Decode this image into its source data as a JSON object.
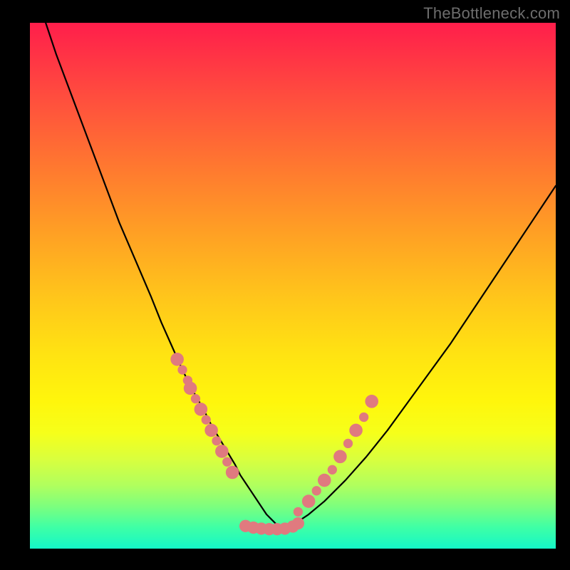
{
  "watermark": "TheBottleneck.com",
  "chart_data": {
    "type": "line",
    "title": "",
    "xlabel": "",
    "ylabel": "",
    "xlim": [
      0,
      100
    ],
    "ylim": [
      0,
      100
    ],
    "series": [
      {
        "name": "curve",
        "x": [
          3,
          5,
          8,
          11,
          14,
          17,
          20,
          23,
          25,
          27,
          29,
          31,
          33,
          34.5,
          36,
          37.5,
          39,
          40,
          41,
          42,
          43,
          44,
          45,
          46,
          47,
          48,
          50,
          53,
          56,
          60,
          64,
          68,
          72,
          76,
          80,
          84,
          88,
          92,
          96,
          100
        ],
        "y": [
          100,
          94,
          86,
          78,
          70,
          62,
          55,
          48,
          43,
          38.5,
          34,
          30,
          26.5,
          23.5,
          21,
          18.5,
          16,
          14,
          12.5,
          11,
          9.5,
          8,
          6.5,
          5.5,
          4.5,
          4,
          4.5,
          6.5,
          9,
          13,
          17.5,
          22.5,
          28,
          33.5,
          39,
          45,
          51,
          57,
          63,
          69
        ]
      }
    ],
    "markers": [
      {
        "x": 28,
        "y": 36,
        "r": 1.4
      },
      {
        "x": 29,
        "y": 34,
        "r": 1.0
      },
      {
        "x": 30,
        "y": 32,
        "r": 1.0
      },
      {
        "x": 30.5,
        "y": 30.5,
        "r": 1.4
      },
      {
        "x": 31.5,
        "y": 28.5,
        "r": 1.0
      },
      {
        "x": 32.5,
        "y": 26.5,
        "r": 1.4
      },
      {
        "x": 33.5,
        "y": 24.5,
        "r": 1.0
      },
      {
        "x": 34.5,
        "y": 22.5,
        "r": 1.4
      },
      {
        "x": 35.5,
        "y": 20.5,
        "r": 1.0
      },
      {
        "x": 36.5,
        "y": 18.5,
        "r": 1.4
      },
      {
        "x": 37.5,
        "y": 16.5,
        "r": 1.0
      },
      {
        "x": 38.5,
        "y": 14.5,
        "r": 1.4
      },
      {
        "x": 41,
        "y": 4.3,
        "r": 1.3
      },
      {
        "x": 42.5,
        "y": 4.0,
        "r": 1.3
      },
      {
        "x": 44,
        "y": 3.8,
        "r": 1.3
      },
      {
        "x": 45.5,
        "y": 3.7,
        "r": 1.3
      },
      {
        "x": 47,
        "y": 3.7,
        "r": 1.3
      },
      {
        "x": 48.5,
        "y": 3.8,
        "r": 1.3
      },
      {
        "x": 50,
        "y": 4.2,
        "r": 1.3
      },
      {
        "x": 51,
        "y": 4.8,
        "r": 1.3
      },
      {
        "x": 51,
        "y": 7,
        "r": 1.0
      },
      {
        "x": 53,
        "y": 9,
        "r": 1.4
      },
      {
        "x": 54.5,
        "y": 11,
        "r": 1.0
      },
      {
        "x": 56,
        "y": 13,
        "r": 1.4
      },
      {
        "x": 57.5,
        "y": 15,
        "r": 1.0
      },
      {
        "x": 59,
        "y": 17.5,
        "r": 1.4
      },
      {
        "x": 60.5,
        "y": 20,
        "r": 1.0
      },
      {
        "x": 62,
        "y": 22.5,
        "r": 1.4
      },
      {
        "x": 63.5,
        "y": 25,
        "r": 1.0
      },
      {
        "x": 65,
        "y": 28,
        "r": 1.4
      }
    ],
    "colors": {
      "curve": "#000000",
      "marker": "#e07a7f"
    }
  }
}
